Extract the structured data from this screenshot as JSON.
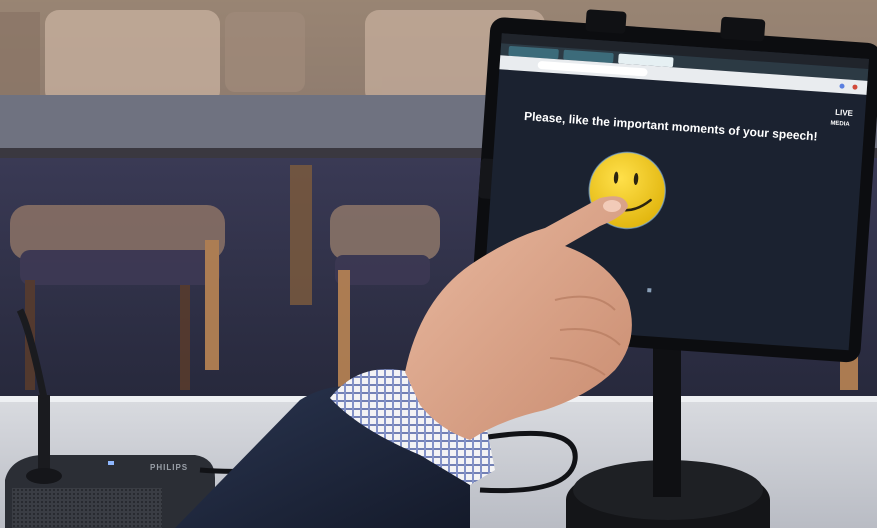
{
  "tablet_screen": {
    "headline": "Please, like the important moments of your speech!",
    "brand_line1": "LIVE",
    "brand_line2": "MEDIA",
    "emoji": "smiley-face-icon"
  },
  "microphone_base": {
    "brand": "PHILIPS"
  },
  "colors": {
    "screen_bg": "#1b2230",
    "emoji_yellow": "#f2cf1e",
    "browser_bar": "#e9ecef"
  }
}
